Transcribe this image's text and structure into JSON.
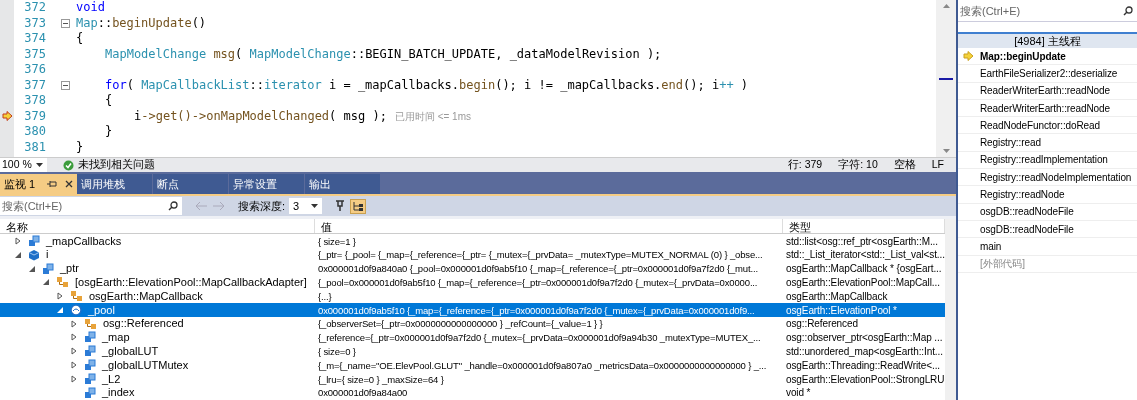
{
  "editor": {
    "lines": [
      {
        "number": "372",
        "kind": "top",
        "foldable": false,
        "current": false,
        "segments": [
          {
            "kind": "keyword",
            "text": "void"
          }
        ]
      },
      {
        "number": "373",
        "kind": "top",
        "foldable": true,
        "current": false,
        "segments": [
          {
            "kind": "type",
            "text": "Map"
          },
          {
            "kind": "plain",
            "text": "::"
          },
          {
            "kind": "func",
            "text": "beginUpdate"
          },
          {
            "kind": "plain",
            "text": "()"
          }
        ]
      },
      {
        "number": "374",
        "kind": "top",
        "foldable": false,
        "current": false,
        "segments": [
          {
            "kind": "plain",
            "text": "{"
          }
        ]
      },
      {
        "number": "375",
        "kind": "block",
        "foldable": false,
        "current": false,
        "segments": [
          {
            "kind": "type",
            "text": "MapModelChange"
          },
          {
            "kind": "func",
            "text": "msg"
          },
          {
            "kind": "plain",
            "text": "( "
          },
          {
            "kind": "type",
            "text": "MapModelChange"
          },
          {
            "kind": "plain",
            "text": "::BEGIN_BATCH_UPDATE, _dataModelRevision );"
          }
        ]
      },
      {
        "number": "376",
        "kind": "block",
        "foldable": false,
        "current": false
      },
      {
        "number": "377",
        "kind": "block",
        "foldable": true,
        "current": false,
        "segments": [
          {
            "kind": "keyword",
            "text": "for"
          },
          {
            "kind": "plain",
            "text": "( "
          },
          {
            "kind": "type",
            "text": "MapCallbackList"
          },
          {
            "kind": "plain",
            "text": "::"
          },
          {
            "kind": "type",
            "text": "iterator"
          },
          {
            "kind": "plain",
            "text": " i = _mapCallbacks."
          },
          {
            "kind": "func",
            "text": "begin"
          },
          {
            "kind": "plain",
            "text": "(); i != _mapCallbacks."
          },
          {
            "kind": "func",
            "text": "end"
          },
          {
            "kind": "plain",
            "text": "(); i"
          },
          {
            "kind": "type",
            "text": "++"
          },
          {
            "kind": "plain",
            "text": " )"
          }
        ]
      },
      {
        "number": "378",
        "kind": "block",
        "foldable": false,
        "current": false,
        "segments": [
          {
            "kind": "plain",
            "text": "{"
          }
        ]
      },
      {
        "number": "379",
        "kind": "inner",
        "foldable": false,
        "current": true,
        "segments": [
          {
            "kind": "plain",
            "text": "i"
          },
          {
            "kind": "func",
            "text": "->get()->onMapModelChanged"
          },
          {
            "kind": "plain",
            "text": "( msg );"
          },
          {
            "kind": "hint",
            "text": "已用时间 <= 1ms"
          }
        ]
      },
      {
        "number": "380",
        "kind": "block",
        "foldable": false,
        "current": false,
        "segments": [
          {
            "kind": "plain",
            "text": "}"
          }
        ]
      },
      {
        "number": "381",
        "kind": "top",
        "foldable": false,
        "current": false,
        "segments": [
          {
            "kind": "plain",
            "text": "}"
          }
        ]
      }
    ],
    "status": {
      "zoom": "100 %",
      "issues": "未找到相关问题",
      "line": "行: 379",
      "char": "字符: 10",
      "spacing": "空格",
      "ending": "LF"
    }
  },
  "watch": {
    "tabs": [
      {
        "label": "监视 1",
        "selected": true
      },
      {
        "label": "调用堆栈",
        "selected": false
      },
      {
        "label": "断点",
        "selected": false
      },
      {
        "label": "异常设置",
        "selected": false
      },
      {
        "label": "输出",
        "selected": false
      }
    ],
    "search": {
      "placeholder": "搜索(Ctrl+E)"
    },
    "depth_label": "搜索深度:",
    "depth": "3",
    "columns": [
      "名称",
      "值",
      "类型"
    ],
    "rows": [
      {
        "name": "_mapCallbacks",
        "value": "{ size=1 }",
        "type": "std::list<osg::ref_ptr<osgEarth::M...",
        "kind": "field",
        "expandable": true,
        "expanded": false,
        "selected": false
      },
      {
        "name": "i",
        "value": "{_ptr= {_pool= {_map={_reference={_ptr= {_mutex={_prvData= _mutexType=MUTEX_NORMAL (0) } _obse...",
        "type": "std::_List_iterator<std::_List_val<st...",
        "kind": "local",
        "expandable": true,
        "expanded": true,
        "selected": false,
        "children": [
          {
            "name": "_ptr",
            "value": "0x000001d0f9a840a0 {_pool=0x000001d0f9ab5f10 {_map={_reference={_ptr=0x000001d0f9a7f2d0 {_mut...",
            "type": "osgEarth::MapCallback * {osgEart...",
            "kind": "field",
            "expandable": true,
            "expanded": true,
            "selected": false,
            "children": [
              {
                "name": "[osgEarth::ElevationPool::MapCallbackAdapter]",
                "value": "{_pool=0x000001d0f9ab5f10 {_map={_reference={_ptr=0x000001d0f9a7f2d0 {_mutex={_prvData=0x0000...",
                "type": "osgEarth::ElevationPool::MapCall...",
                "kind": "base",
                "expandable": true,
                "expanded": true,
                "selected": false,
                "children": [
                  {
                    "name": "osgEarth::MapCallback",
                    "value": "{...}",
                    "type": "osgEarth::MapCallback",
                    "kind": "base",
                    "expandable": true,
                    "expanded": false,
                    "selected": false
                  },
                  {
                    "name": "_pool",
                    "value": "0x000001d0f9ab5f10 {_map={_reference={_ptr=0x000001d0f9a7f2d0 {_mutex={_prvData=0x000001d0f9...",
                    "type": "osgEarth::ElevationPool *",
                    "kind": "pointer",
                    "expandable": true,
                    "expanded": true,
                    "selected": true,
                    "children": [
                      {
                        "name": "osg::Referenced",
                        "value": "{_observerSet={_ptr=0x0000000000000000 } _refCount={_value=1 } }",
                        "type": "osg::Referenced",
                        "kind": "base",
                        "expandable": true,
                        "expanded": false,
                        "selected": false
                      },
                      {
                        "name": "_map",
                        "value": "{_reference={_ptr=0x000001d0f9a7f2d0 {_mutex={_prvData=0x000001d0f9a94b30 _mutexType=MUTEX_...",
                        "type": "osg::observer_ptr<osgEarth::Map ...",
                        "kind": "field",
                        "expandable": true,
                        "expanded": false,
                        "selected": false
                      },
                      {
                        "name": "_globalLUT",
                        "value": "{ size=0 }",
                        "type": "std::unordered_map<osgEarth::Int...",
                        "kind": "field",
                        "expandable": true,
                        "expanded": false,
                        "selected": false
                      },
                      {
                        "name": "_globalLUTMutex",
                        "value": "{_m={_name=\"OE.ElevPool.GLUT\" _handle=0x000001d0f9a807a0 _metricsData=0x0000000000000000 } _...",
                        "type": "osgEarth::Threading::ReadWrite<...",
                        "kind": "field",
                        "expandable": true,
                        "expanded": false,
                        "selected": false
                      },
                      {
                        "name": "_L2",
                        "value": "{_lru={ size=0 } _maxSize=64 }",
                        "type": "osgEarth::ElevationPool::StrongLRU",
                        "kind": "field",
                        "expandable": true,
                        "expanded": false,
                        "selected": false
                      },
                      {
                        "name": "_index",
                        "value": "0x000001d0f9a84a00",
                        "type": "void *",
                        "kind": "field",
                        "expandable": false,
                        "expanded": false,
                        "selected": false
                      }
                    ]
                  }
                ]
              }
            ]
          }
        ]
      }
    ]
  },
  "callstack": {
    "search": {
      "placeholder": "搜索(Ctrl+E)"
    },
    "thread": "[4984] 主线程",
    "frames": [
      {
        "label": "Map::beginUpdate",
        "kind": "current"
      },
      {
        "label": "EarthFileSerializer2::deserialize",
        "kind": "frame"
      },
      {
        "label": "ReaderWriterEarth::readNode",
        "kind": "frame"
      },
      {
        "label": "ReaderWriterEarth::readNode",
        "kind": "frame"
      },
      {
        "label": "ReadNodeFunctor::doRead",
        "kind": "frame"
      },
      {
        "label": "Registry::read",
        "kind": "frame"
      },
      {
        "label": "Registry::readImplementation",
        "kind": "frame"
      },
      {
        "label": "Registry::readNodeImplementation",
        "kind": "frame"
      },
      {
        "label": "Registry::readNode",
        "kind": "frame"
      },
      {
        "label": "osgDB::readNodeFile",
        "kind": "frame"
      },
      {
        "label": "osgDB::readNodeFile",
        "kind": "frame"
      },
      {
        "label": "main",
        "kind": "frame"
      },
      {
        "label": "[外部代码]",
        "kind": "external"
      }
    ]
  }
}
